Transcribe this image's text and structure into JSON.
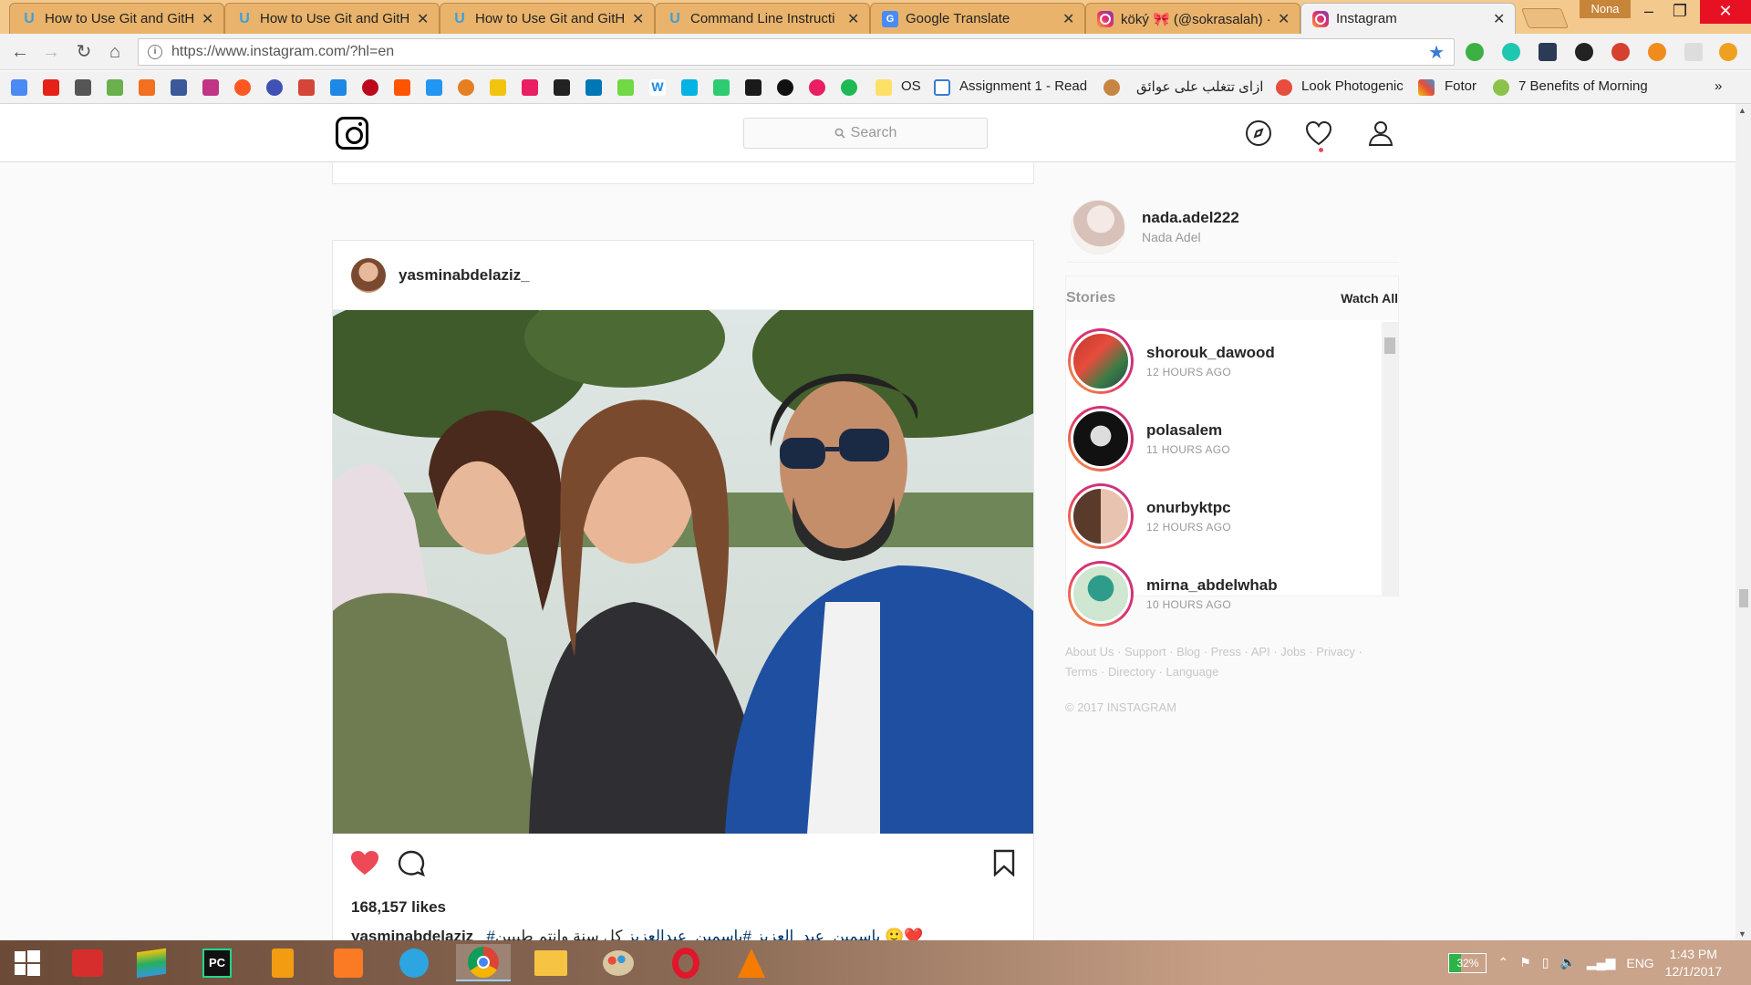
{
  "browser": {
    "tabs": [
      {
        "title": "How to Use Git and GitH",
        "icon": "udacity-icon"
      },
      {
        "title": "How to Use Git and GitH",
        "icon": "udacity-icon"
      },
      {
        "title": "How to Use Git and GitH",
        "icon": "udacity-icon"
      },
      {
        "title": "Command Line Instructi",
        "icon": "udacity-icon"
      },
      {
        "title": "Google Translate",
        "icon": "google-translate-icon"
      },
      {
        "title": "köký 🎀 (@sokrasalah) ·",
        "icon": "instagram-icon"
      },
      {
        "title": "Instagram",
        "icon": "instagram-icon",
        "active": true
      }
    ],
    "profile_name": "Nona",
    "url": "https://www.instagram.com/?hl=en",
    "bookmarks": [
      {
        "label": "OS"
      },
      {
        "label": "Assignment 1 - Read"
      },
      {
        "label": "ازاى تتغلب على عوائق"
      },
      {
        "label": "Look Photogenic"
      },
      {
        "label": "Fotor"
      },
      {
        "label": "7 Benefits of Morning"
      }
    ],
    "overflow": "»"
  },
  "instagram": {
    "search_placeholder": "Search",
    "post": {
      "username": "yasminabdelaziz_",
      "likes": "168,157 likes",
      "caption_user": "yasminabdelaziz_",
      "caption_tags": "#ياسمين_عبد_العزيز  #ياسمين_عبدالعزيز",
      "caption_text": "كل سنة وانتم طيبين 🙂❤️"
    },
    "me": {
      "username": "nada.adel222",
      "name": "Nada Adel"
    },
    "stories": {
      "title": "Stories",
      "watch_all": "Watch All",
      "items": [
        {
          "username": "shorouk_dawood",
          "time": "12 HOURS AGO"
        },
        {
          "username": "polasalem",
          "time": "11 HOURS AGO"
        },
        {
          "username": "onurbyktpc",
          "time": "12 HOURS AGO"
        },
        {
          "username": "mirna_abdelwhab",
          "time": "10 HOURS AGO"
        }
      ]
    },
    "footer_line1": "About Us · Support · Blog · Press · API · Jobs · Privacy ·",
    "footer_line2": "Terms · Directory · Language",
    "copyright": "© 2017 INSTAGRAM"
  },
  "taskbar": {
    "battery": "32%",
    "language": "ENG",
    "time": "1:43 PM",
    "date": "12/1/2017"
  },
  "colors": {
    "heart": "#ed4956",
    "tag_link": "#003569",
    "story_ring": "#e1306c"
  }
}
